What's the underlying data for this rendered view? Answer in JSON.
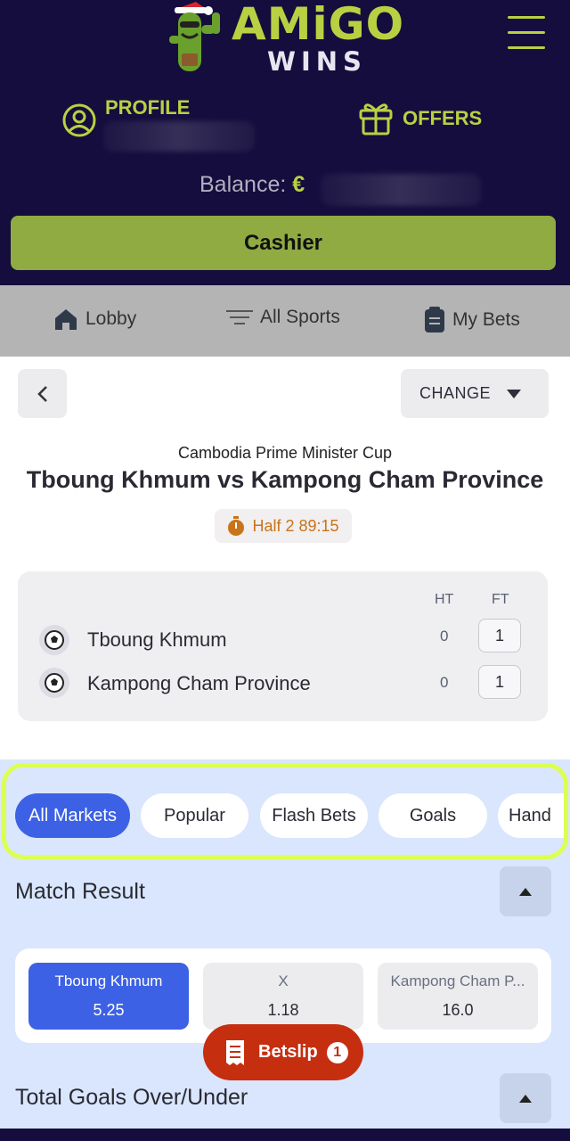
{
  "header": {
    "brand_top": "AMiGO",
    "brand_bottom": "WINS",
    "profile_label": "PROFILE",
    "offers_label": "OFFERS",
    "balance_label": "Balance:",
    "currency": "€",
    "cashier_label": "Cashier",
    "accent_color": "#b8d142",
    "background_color": "#150d3d"
  },
  "nav": {
    "lobby": "Lobby",
    "all_sports": "All Sports",
    "my_bets": "My Bets"
  },
  "event": {
    "change_label": "CHANGE",
    "league": "Cambodia Prime Minister Cup",
    "title": "Tboung Khmum vs Kampong Cham Province",
    "clock": "Half 2 89:15",
    "col_ht": "HT",
    "col_ft": "FT",
    "teams": [
      {
        "name": "Tboung Khmum",
        "ht": "0",
        "ft": "1"
      },
      {
        "name": "Kampong Cham Province",
        "ht": "0",
        "ft": "1"
      }
    ]
  },
  "markets": {
    "tabs": [
      "All Markets",
      "Popular",
      "Flash Bets",
      "Goals",
      "Hand"
    ],
    "active_tab": "All Markets",
    "match_result_title": "Match Result",
    "outcomes": [
      {
        "name": "Tboung Khmum",
        "price": "5.25",
        "selected": true
      },
      {
        "name": "X",
        "price": "1.18",
        "selected": false
      },
      {
        "name": "Kampong Cham P...",
        "price": "16.0",
        "selected": false
      }
    ],
    "total_goals_title": "Total Goals Over/Under",
    "selected_color": "#3d61e4"
  },
  "betslip": {
    "label": "Betslip",
    "count": "1",
    "color": "#c62e10"
  }
}
